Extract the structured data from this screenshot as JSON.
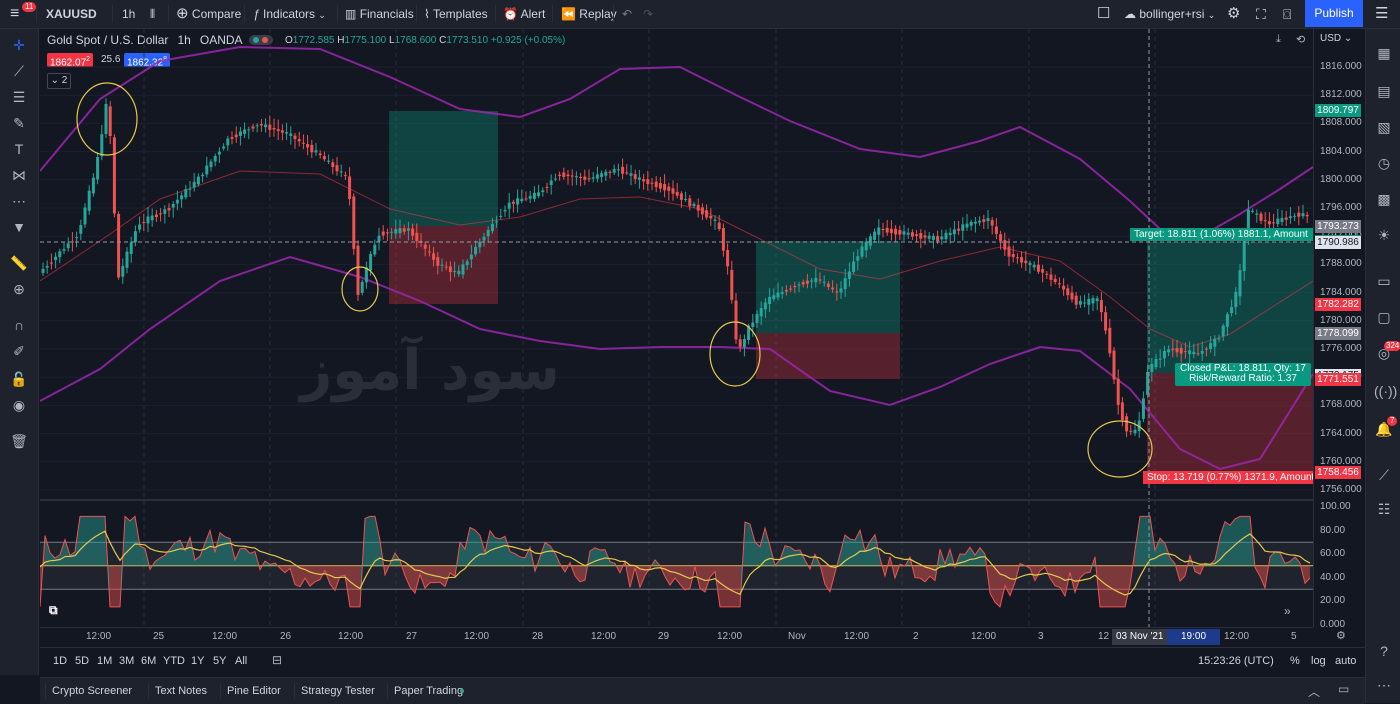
{
  "topbar": {
    "notif_badge": "11",
    "symbol": "XAUUSD",
    "interval": "1h",
    "compare": "Compare",
    "indicators": "Indicators",
    "financials": "Financials",
    "templates": "Templates",
    "alert": "Alert",
    "replay": "Replay",
    "layout_name": "bollinger+rsi",
    "publish": "Publish"
  },
  "legend": {
    "title": "Gold Spot / U.S. Dollar",
    "interval": "1h",
    "source": "OANDA",
    "o_label": "O",
    "o_value": "1772.585",
    "h_label": "H",
    "h_value": "1775.100",
    "l_label": "L",
    "l_value": "1768.600",
    "c_label": "C",
    "c_value": "1773.510",
    "change": "+0.925 (+0.05%)",
    "sell_price": "1862.07",
    "sell_sup": "2",
    "spread": "25.6",
    "buy_price": "1862.32",
    "buy_sup": "8",
    "collapse_count": "2"
  },
  "currency": "USD",
  "price_axis": {
    "ticks": [
      "1816.000",
      "1812.000",
      "1808.000",
      "1804.000",
      "1800.000",
      "1796.000",
      "1792.000",
      "1788.000",
      "1784.000",
      "1780.000",
      "1776.000",
      "1772.000",
      "1768.000",
      "1764.000",
      "1760.000",
      "1756.000"
    ],
    "badges": [
      {
        "text": "1809.797",
        "color": "#089981"
      },
      {
        "text": "1793.273",
        "color": "#787b86"
      },
      {
        "text": "1791.194",
        "color": "#089981"
      },
      {
        "text": "1790.986",
        "color": "#131722"
      },
      {
        "text": "1782.282",
        "color": "#f23645"
      },
      {
        "text": "1778.099",
        "color": "#787b86"
      },
      {
        "text": "1772.175",
        "color": "#131722"
      },
      {
        "text": "1771.551",
        "color": "#f23645"
      },
      {
        "text": "1758.456",
        "color": "#f23645"
      }
    ],
    "rsi_ticks": [
      "100.00",
      "80.00",
      "60.00",
      "40.00",
      "20.00",
      "0.000"
    ]
  },
  "time_axis": {
    "labels": [
      "12:00",
      "25",
      "12:00",
      "26",
      "12:00",
      "27",
      "12:00",
      "28",
      "12:00",
      "29",
      "12:00",
      "Nov",
      "12:00",
      "2",
      "12:00",
      "3",
      "12",
      "03 Nov '21",
      "19:00",
      "12:00",
      "5"
    ]
  },
  "positions": {
    "target_label": "Target: 18.811 (1.06%) 1881.1, Amount",
    "stop_label": "Stop: 13.719 (0.77%) 1371.9, Amount",
    "closed_pl": "Closed P&L: 18.811, Qty: 17",
    "risk_reward": "Risk/Reward Ratio: 1.37"
  },
  "watermark": "سود آموز",
  "bottom_ranges": [
    "1D",
    "5D",
    "1M",
    "3M",
    "6M",
    "YTD",
    "1Y",
    "5Y",
    "All"
  ],
  "clock": "15:23:26 (UTC)",
  "scale_opts": [
    "%",
    "log",
    "auto"
  ],
  "bottom_tabs": [
    "Crypto Screener",
    "Text Notes",
    "Pine Editor",
    "Strategy Tester",
    "Paper Trading"
  ],
  "right_badges": {
    "ideas": "324",
    "notifications": "7"
  },
  "colors": {
    "bull": "#26a69a",
    "bear": "#ef5350",
    "bands": "#9c27b0",
    "accent": "#2962ff"
  }
}
